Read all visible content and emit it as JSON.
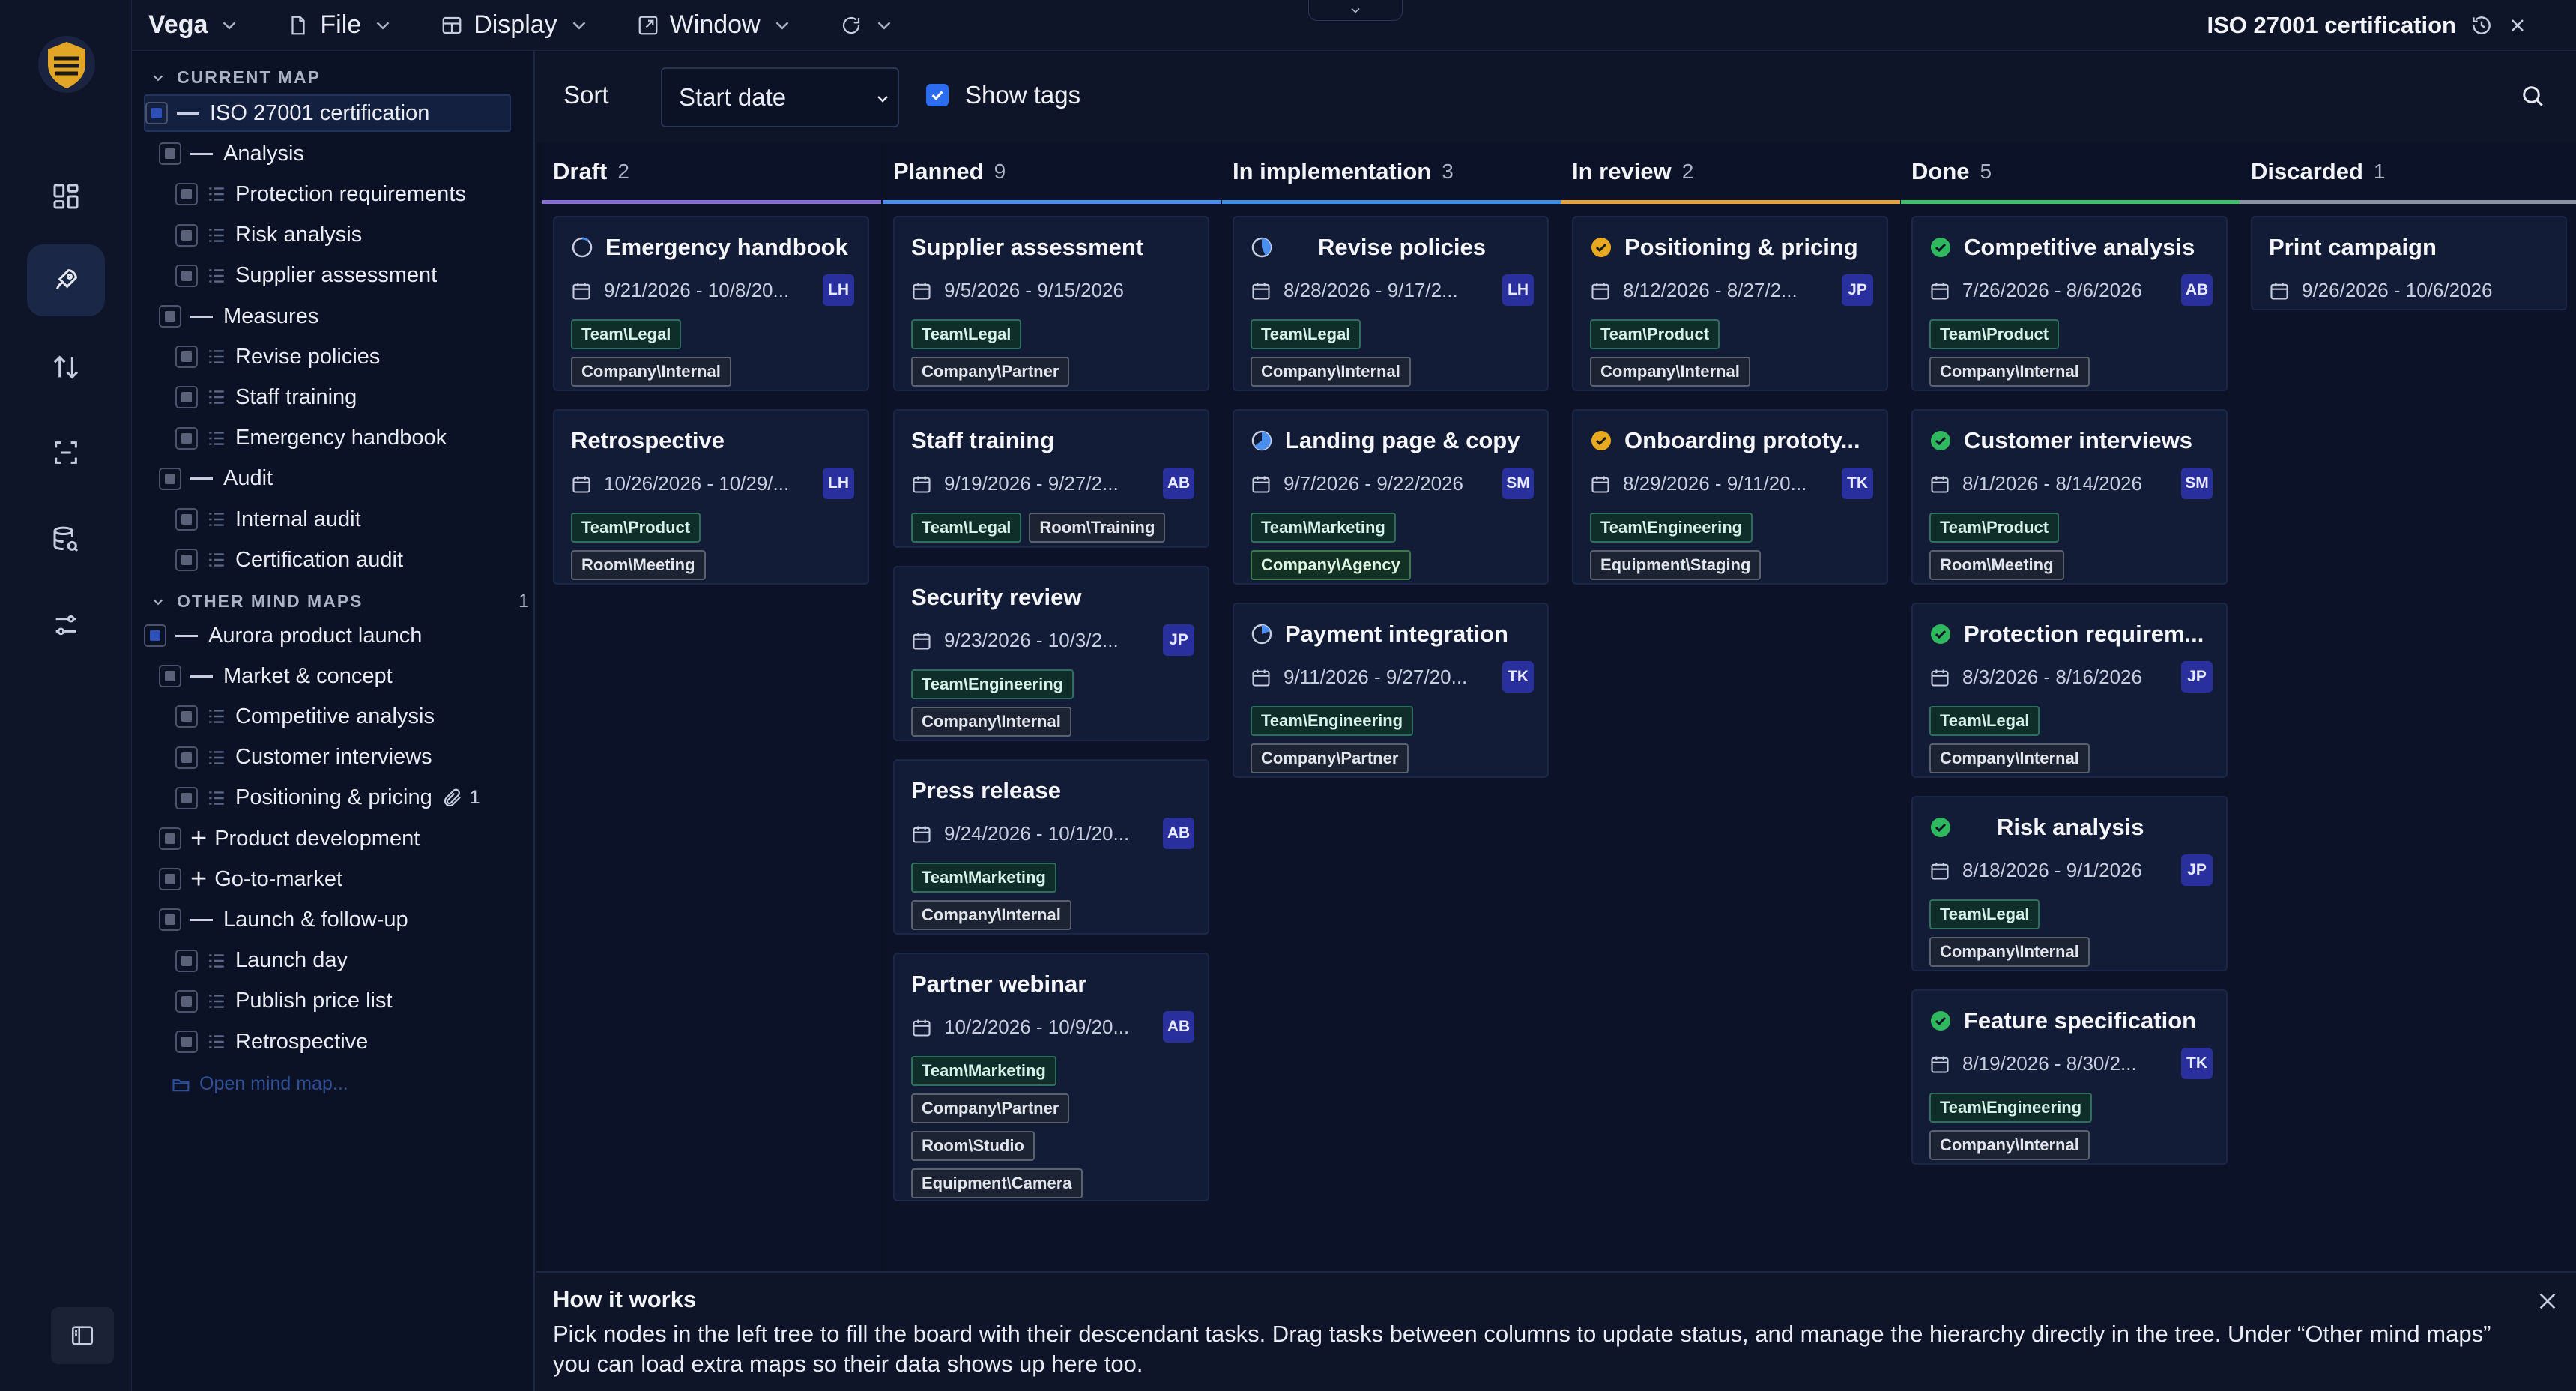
{
  "app": {
    "name": "Vega",
    "title": "ISO 27001 certification"
  },
  "menu": {
    "file": "File",
    "display": "Display",
    "window": "Window"
  },
  "tree": {
    "current_map_label": "CURRENT MAP",
    "other_maps_label": "OTHER MIND MAPS",
    "other_maps_count": "1",
    "current": [
      {
        "label": "ISO 27001 certification",
        "kind": "root"
      },
      {
        "label": "Analysis",
        "kind": "group"
      },
      {
        "label": "Protection requirements",
        "kind": "task"
      },
      {
        "label": "Risk analysis",
        "kind": "task"
      },
      {
        "label": "Supplier assessment",
        "kind": "task"
      },
      {
        "label": "Measures",
        "kind": "group"
      },
      {
        "label": "Revise policies",
        "kind": "task"
      },
      {
        "label": "Staff training",
        "kind": "task"
      },
      {
        "label": "Emergency handbook",
        "kind": "task"
      },
      {
        "label": "Audit",
        "kind": "group"
      },
      {
        "label": "Internal audit",
        "kind": "task"
      },
      {
        "label": "Certification audit",
        "kind": "task"
      }
    ],
    "other": [
      {
        "label": "Aurora product launch",
        "kind": "root"
      },
      {
        "label": "Market & concept",
        "kind": "group"
      },
      {
        "label": "Competitive analysis",
        "kind": "task"
      },
      {
        "label": "Customer interviews",
        "kind": "task"
      },
      {
        "label": "Positioning & pricing",
        "kind": "task",
        "attachments": "1"
      },
      {
        "label": "Product development",
        "kind": "collapsed"
      },
      {
        "label": "Go-to-market",
        "kind": "collapsed"
      },
      {
        "label": "Launch & follow-up",
        "kind": "group"
      },
      {
        "label": "Launch day",
        "kind": "task"
      },
      {
        "label": "Publish price list",
        "kind": "task"
      },
      {
        "label": "Retrospective",
        "kind": "task"
      }
    ],
    "open_map": "Open mind map..."
  },
  "toolbar": {
    "sort_label": "Sort",
    "sort_value": "Start date",
    "show_tags": "Show tags"
  },
  "columns": [
    {
      "name": "Draft",
      "count": "2",
      "color": "#8a6fd6",
      "cards": [
        {
          "title": "Emergency handbook",
          "status": "progress-low",
          "dates": "9/21/2026 - 10/8/20...",
          "av": "LH",
          "tags": [
            [
              "Team\\Legal",
              "team"
            ],
            [
              "Company\\Internal",
              "co"
            ]
          ]
        },
        {
          "title": "Retrospective",
          "status": "",
          "dates": "10/26/2026 - 10/29/...",
          "av": "LH",
          "tags": [
            [
              "Team\\Product",
              "team"
            ],
            [
              "Room\\Meeting",
              "room"
            ]
          ]
        }
      ]
    },
    {
      "name": "Planned",
      "count": "9",
      "color": "#4a8ef0",
      "cards": [
        {
          "title": "Supplier assessment",
          "status": "",
          "dates": "9/5/2026 - 9/15/2026",
          "av": "",
          "tags": [
            [
              "Team\\Legal",
              "team"
            ],
            [
              "Company\\Partner",
              "co"
            ]
          ]
        },
        {
          "title": "Staff training",
          "status": "",
          "dates": "9/19/2026 - 9/27/2...",
          "av": "AB",
          "tags": [
            [
              "Team\\Legal",
              "team"
            ],
            [
              "Room\\Training",
              "room"
            ]
          ]
        },
        {
          "title": "Security review",
          "status": "",
          "dates": "9/23/2026 - 10/3/2...",
          "av": "JP",
          "tags": [
            [
              "Team\\Engineering",
              "team"
            ],
            [
              "Company\\Internal",
              "co"
            ]
          ]
        },
        {
          "title": "Press release",
          "status": "",
          "dates": "9/24/2026 - 10/1/20...",
          "av": "AB",
          "tags": [
            [
              "Team\\Marketing",
              "team"
            ],
            [
              "Company\\Internal",
              "co"
            ]
          ]
        },
        {
          "title": "Partner webinar",
          "status": "",
          "dates": "10/2/2026 - 10/9/20...",
          "av": "AB",
          "tags": [
            [
              "Team\\Marketing",
              "team"
            ],
            [
              "Company\\Partner",
              "co"
            ],
            [
              "Room\\Studio",
              "room"
            ],
            [
              "Equipment\\Camera",
              "eq"
            ]
          ]
        }
      ]
    },
    {
      "name": "In implementation",
      "count": "3",
      "color": "#3b8fe8",
      "cards": [
        {
          "title": "Revise policies",
          "status": "progress-mid",
          "dates": "8/28/2026 - 9/17/2...",
          "av": "LH",
          "tags": [
            [
              "Team\\Legal",
              "team"
            ],
            [
              "Company\\Internal",
              "co"
            ]
          ]
        },
        {
          "title": "Landing page & copy",
          "status": "progress-high",
          "dates": "9/7/2026 - 9/22/2026",
          "av": "SM",
          "tags": [
            [
              "Team\\Marketing",
              "team"
            ],
            [
              "Company\\Agency",
              "agency"
            ]
          ]
        },
        {
          "title": "Payment integration",
          "status": "progress-low2",
          "dates": "9/11/2026 - 9/27/20...",
          "av": "TK",
          "tags": [
            [
              "Team\\Engineering",
              "team"
            ],
            [
              "Company\\Partner",
              "co"
            ]
          ]
        }
      ]
    },
    {
      "name": "In review",
      "count": "2",
      "color": "#e8a33a",
      "cards": [
        {
          "title": "Positioning & pricing",
          "status": "review",
          "dates": "8/12/2026 - 8/27/2...",
          "av": "JP",
          "tags": [
            [
              "Team\\Product",
              "team"
            ],
            [
              "Company\\Internal",
              "co"
            ]
          ]
        },
        {
          "title": "Onboarding prototy...",
          "status": "review",
          "dates": "8/29/2026 - 9/11/20...",
          "av": "TK",
          "tags": [
            [
              "Team\\Engineering",
              "team"
            ],
            [
              "Equipment\\Staging",
              "eq"
            ]
          ]
        }
      ]
    },
    {
      "name": "Done",
      "count": "5",
      "color": "#3fc06a",
      "cards": [
        {
          "title": "Competitive analysis",
          "status": "done",
          "dates": "7/26/2026 - 8/6/2026",
          "av": "AB",
          "tags": [
            [
              "Team\\Product",
              "team"
            ],
            [
              "Company\\Internal",
              "co"
            ]
          ]
        },
        {
          "title": "Customer interviews",
          "status": "done",
          "dates": "8/1/2026 - 8/14/2026",
          "av": "SM",
          "tags": [
            [
              "Team\\Product",
              "team"
            ],
            [
              "Room\\Meeting",
              "room"
            ]
          ]
        },
        {
          "title": "Protection requirem...",
          "status": "done",
          "dates": "8/3/2026 - 8/16/2026",
          "av": "JP",
          "tags": [
            [
              "Team\\Legal",
              "team"
            ],
            [
              "Company\\Internal",
              "co"
            ]
          ]
        },
        {
          "title": "Risk analysis",
          "status": "done",
          "dates": "8/18/2026 - 9/1/2026",
          "av": "JP",
          "tags": [
            [
              "Team\\Legal",
              "team"
            ],
            [
              "Company\\Internal",
              "co"
            ]
          ]
        },
        {
          "title": "Feature specification",
          "status": "done",
          "dates": "8/19/2026 - 8/30/2...",
          "av": "TK",
          "tags": [
            [
              "Team\\Engineering",
              "team"
            ],
            [
              "Company\\Internal",
              "co"
            ]
          ]
        }
      ]
    },
    {
      "name": "Discarded",
      "count": "1",
      "color": "#8c93a3",
      "cards": [
        {
          "title": "Print campaign",
          "status": "",
          "dates": "9/26/2026 - 10/6/2026",
          "av": "",
          "tags": []
        }
      ]
    }
  ],
  "how": {
    "title": "How it works",
    "body": "Pick nodes in the left tree to fill the board with their descendant tasks. Drag tasks between columns to update status, and manage the hierarchy directly in the tree. Under “Other mind maps” you can load extra maps so their data shows up here too."
  }
}
